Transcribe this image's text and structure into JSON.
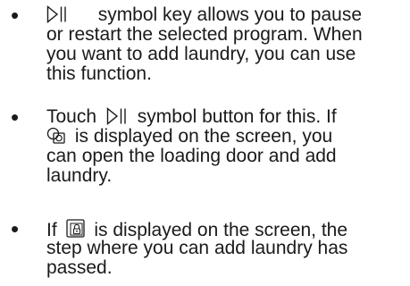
{
  "bullets": [
    {
      "marker": "•",
      "line1_after_icon": "symbol key allows you to pause",
      "line2": "or restart the selected program. When",
      "line3": "you want to add laundry, you can use",
      "line4": "this function.",
      "icon": "play-pause-icon"
    },
    {
      "marker": "•",
      "line1_before_icon": "Touch",
      "line1_after_icon": "symbol button for this. If",
      "line2_after_icon": "is displayed on the screen, you",
      "line3": "can open the loading door and add",
      "line4": "laundry.",
      "icons": [
        "play-pause-icon",
        "add-laundry-icon"
      ]
    },
    {
      "marker": "•",
      "line1_before_icon": "If",
      "line1_after_icon": "is displayed on the screen, the",
      "line2": "step where you can add laundry has",
      "line3": "passed.",
      "icon": "door-locked-icon"
    }
  ]
}
